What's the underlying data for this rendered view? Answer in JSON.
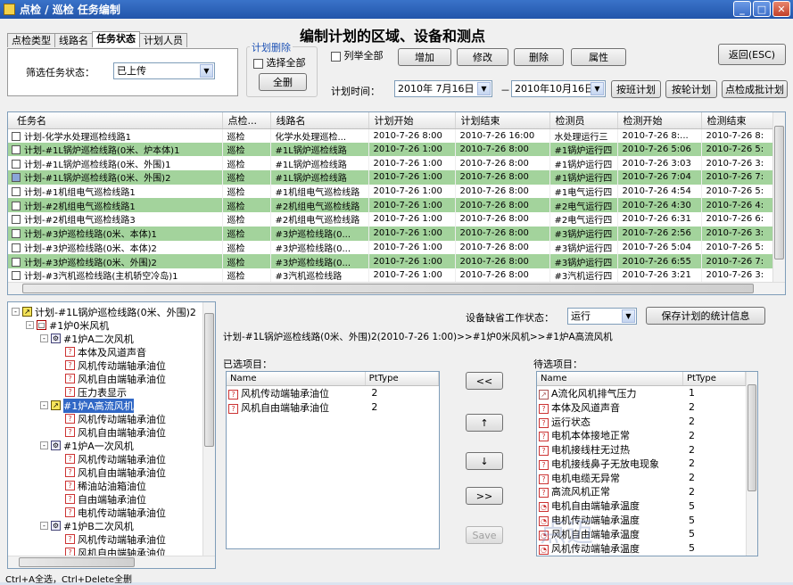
{
  "window": {
    "title": "点检 / 巡检   任务编制"
  },
  "tabs": [
    "点检类型",
    "线路名",
    "任务状态",
    "计划人员"
  ],
  "filter": {
    "label": "筛选任务状态：",
    "value": "已上传"
  },
  "plan_delete": {
    "title": "计划删除",
    "select_all": "选择全部",
    "delete_all": "全删"
  },
  "heading": "编制计划的区域、设备和测点",
  "list_all": "列举全部",
  "buttons": {
    "add": "增加",
    "modify": "修改",
    "delete": "删除",
    "properties": "属性",
    "back": "返回(ESC)",
    "by_shift": "按班计划",
    "by_rotation": "按轮计划",
    "batch": "点检成批计划",
    "save_stats": "保存计划的统计信息",
    "move_left": "<<",
    "up": "↑",
    "down": "↓",
    "move_right": ">>",
    "save": "Save"
  },
  "plan_time": {
    "label": "计划时间：",
    "start": "2010年 7月16日",
    "sep": "－",
    "end": "2010年10月16日"
  },
  "grid": {
    "columns": [
      "任务名",
      "点检...",
      "线路名",
      "计划开始",
      "计划结束",
      "检测员",
      "检测开始",
      "检测结束"
    ],
    "rows": [
      {
        "c": [
          "计划-化学水处理巡检线路1",
          "巡检",
          "化学水处理巡检...",
          "2010-7-26 8:00",
          "2010-7-26 16:00",
          "水处理运行三",
          "2010-7-26 8:...",
          "2010-7-26 8:"
        ],
        "hl": false
      },
      {
        "c": [
          "计划-#1L锅炉巡检线路(0米、炉本体)1",
          "巡检",
          "#1L锅炉巡检线路",
          "2010-7-26 1:00",
          "2010-7-26 8:00",
          "#1锅炉运行四",
          "2010-7-26 5:06",
          "2010-7-26 5:"
        ],
        "hl": true
      },
      {
        "c": [
          "计划-#1L锅炉巡检线路(0米、外围)1",
          "巡检",
          "#1L锅炉巡检线路",
          "2010-7-26 1:00",
          "2010-7-26 8:00",
          "#1锅炉运行四",
          "2010-7-26 3:03",
          "2010-7-26 3:"
        ],
        "hl": false
      },
      {
        "c": [
          "计划-#1L锅炉巡检线路(0米、外围)2",
          "巡检",
          "#1L锅炉巡检线路",
          "2010-7-26 1:00",
          "2010-7-26 8:00",
          "#1锅炉运行四",
          "2010-7-26 7:04",
          "2010-7-26 7:"
        ],
        "hl": false,
        "sel": true
      },
      {
        "c": [
          "计划-#1机组电气巡检线路1",
          "巡检",
          "#1机组电气巡检线路",
          "2010-7-26 1:00",
          "2010-7-26 8:00",
          "#1电气运行四",
          "2010-7-26 4:54",
          "2010-7-26 5:"
        ],
        "hl": false
      },
      {
        "c": [
          "计划-#2机组电气巡检线路1",
          "巡检",
          "#2机组电气巡检线路",
          "2010-7-26 1:00",
          "2010-7-26 8:00",
          "#2电气运行四",
          "2010-7-26 4:30",
          "2010-7-26 4:"
        ],
        "hl": true
      },
      {
        "c": [
          "计划-#2机组电气巡检线路3",
          "巡检",
          "#2机组电气巡检线路",
          "2010-7-26 1:00",
          "2010-7-26 8:00",
          "#2电气运行四",
          "2010-7-26 6:31",
          "2010-7-26 6:"
        ],
        "hl": false
      },
      {
        "c": [
          "计划-#3炉巡检线路(0米、本体)1",
          "巡检",
          "#3炉巡检线路(0...",
          "2010-7-26 1:00",
          "2010-7-26 8:00",
          "#3锅炉运行四",
          "2010-7-26 2:56",
          "2010-7-26 3:"
        ],
        "hl": true
      },
      {
        "c": [
          "计划-#3炉巡检线路(0米、本体)2",
          "巡检",
          "#3炉巡检线路(0...",
          "2010-7-26 1:00",
          "2010-7-26 8:00",
          "#3锅炉运行四",
          "2010-7-26 5:04",
          "2010-7-26 5:"
        ],
        "hl": false
      },
      {
        "c": [
          "计划-#3炉巡检线路(0米、外围)2",
          "巡检",
          "#3炉巡检线路(0...",
          "2010-7-26 1:00",
          "2010-7-26 8:00",
          "#3锅炉运行四",
          "2010-7-26 6:55",
          "2010-7-26 7:"
        ],
        "hl": true
      },
      {
        "c": [
          "计划-#3汽机巡检线路(主机轿空冷岛)1",
          "巡检",
          "#3汽机巡检线路",
          "2010-7-26 1:00",
          "2010-7-26 8:00",
          "#3汽机运行四",
          "2010-7-26 3:21",
          "2010-7-26 3:"
        ],
        "hl": false
      }
    ]
  },
  "tree": [
    {
      "label": "计划-#1L锅炉巡检线路(0米、外围)2",
      "level": 0,
      "icon": "edit",
      "exp": "-"
    },
    {
      "label": "#1炉0米风机",
      "level": 1,
      "icon": "dev",
      "exp": "-"
    },
    {
      "label": "#1炉A二次风机",
      "level": 2,
      "icon": "sys",
      "exp": "-"
    },
    {
      "label": "本体及风道声音",
      "level": 3,
      "icon": "q"
    },
    {
      "label": "风机传动端轴承油位",
      "level": 3,
      "icon": "q"
    },
    {
      "label": "风机自由端轴承油位",
      "level": 3,
      "icon": "q"
    },
    {
      "label": "压力表显示",
      "level": 3,
      "icon": "q"
    },
    {
      "label": "#1炉A高流风机",
      "level": 2,
      "icon": "edit",
      "exp": "-",
      "sel": true
    },
    {
      "label": "风机传动端轴承油位",
      "level": 3,
      "icon": "q"
    },
    {
      "label": "风机自由端轴承油位",
      "level": 3,
      "icon": "q"
    },
    {
      "label": "#1炉A一次风机",
      "level": 2,
      "icon": "sys",
      "exp": "-"
    },
    {
      "label": "风机传动端轴承油位",
      "level": 3,
      "icon": "q"
    },
    {
      "label": "风机自由端轴承油位",
      "level": 3,
      "icon": "q"
    },
    {
      "label": "稀油站油箱油位",
      "level": 3,
      "icon": "q"
    },
    {
      "label": "自由端轴承油位",
      "level": 3,
      "icon": "q"
    },
    {
      "label": "电机传动端轴承油位",
      "level": 3,
      "icon": "q"
    },
    {
      "label": "#1炉B二次风机",
      "level": 2,
      "icon": "sys",
      "exp": "-"
    },
    {
      "label": "风机传动端轴承油位",
      "level": 3,
      "icon": "q"
    },
    {
      "label": "风机自由端轴承油位",
      "level": 3,
      "icon": "q"
    }
  ],
  "device_state": {
    "label": "设备缺省工作状态：",
    "value": "运行"
  },
  "path": "计划-#1L锅炉巡检线路(0米、外围)2(2010-7-26 1:00)>>#1炉0米风机>>#1炉A高流风机",
  "selected": {
    "title": "已选项目：",
    "columns": [
      "Name",
      "PtType"
    ],
    "rows": [
      [
        "风机传动端轴承油位",
        "2"
      ],
      [
        "风机自由端轴承油位",
        "2"
      ]
    ]
  },
  "candidates": {
    "title": "待选项目：",
    "columns": [
      "Name",
      "PtType"
    ],
    "rows": [
      [
        "A流化风机排气压力",
        "1"
      ],
      [
        "本体及风道声音",
        "2"
      ],
      [
        "运行状态",
        "2"
      ],
      [
        "电机本体接地正常",
        "2"
      ],
      [
        "电机接线柱无过热",
        "2"
      ],
      [
        "电机接线鼻子无放电现象",
        "2"
      ],
      [
        "电机电缆无异常",
        "2"
      ],
      [
        "高流风机正常",
        "2"
      ],
      [
        "电机自由端轴承温度",
        "5"
      ],
      [
        "电机传动端轴承温度",
        "5"
      ],
      [
        "风机自由端轴承温度",
        "5"
      ],
      [
        "风机传动端轴承温度",
        "5"
      ]
    ]
  },
  "statusbar": "Ctrl+A全选，Ctrl+Delete全删",
  "watermark": "点迈"
}
